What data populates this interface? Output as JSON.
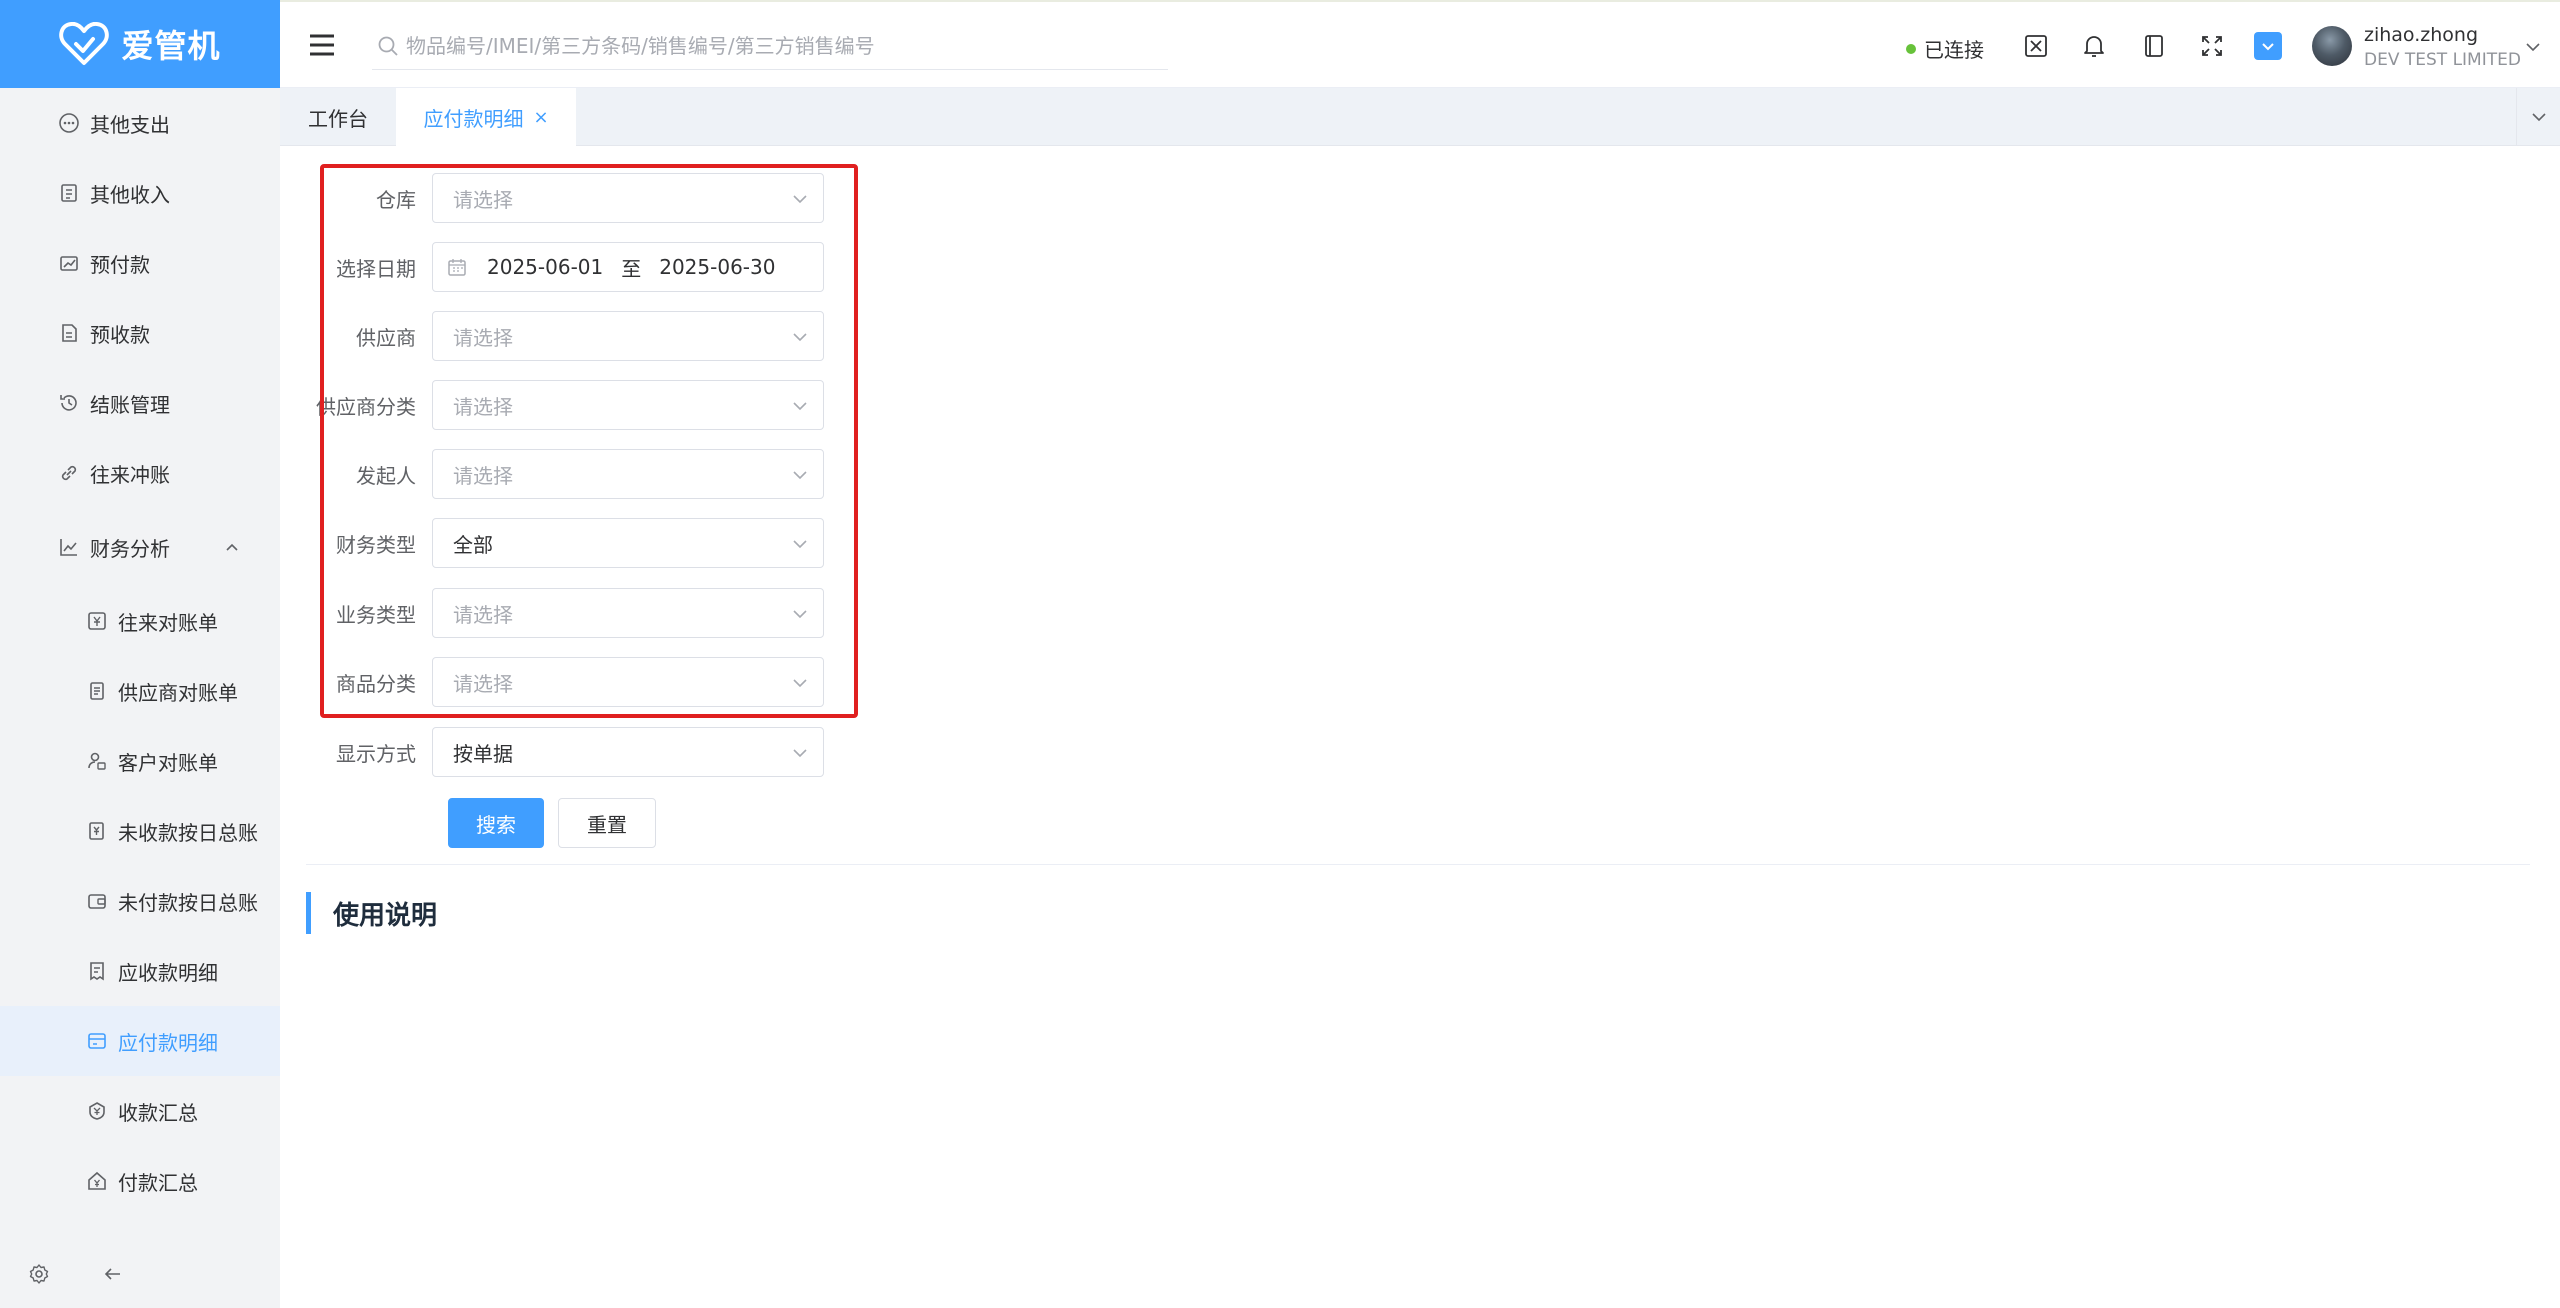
{
  "app": {
    "logo_text": "爱管机",
    "brand_color": "#409eff"
  },
  "sidebar": {
    "items": [
      {
        "label": "其他支出",
        "icon": "dots-circle-icon",
        "level": 1
      },
      {
        "label": "其他收入",
        "icon": "ledger-icon",
        "level": 1
      },
      {
        "label": "预付款",
        "icon": "chart-card-icon",
        "level": 1
      },
      {
        "label": "预收款",
        "icon": "document-icon",
        "level": 1
      },
      {
        "label": "结账管理",
        "icon": "history-icon",
        "level": 1
      },
      {
        "label": "往来冲账",
        "icon": "link-icon",
        "level": 1
      },
      {
        "label": "财务分析",
        "icon": "analysis-icon",
        "level": 1,
        "expanded": true
      },
      {
        "label": "往来对账单",
        "icon": "yen-card-icon",
        "level": 2
      },
      {
        "label": "供应商对账单",
        "icon": "doc-list-icon",
        "level": 2
      },
      {
        "label": "客户对账单",
        "icon": "user-lock-icon",
        "level": 2
      },
      {
        "label": "未收款按日总账",
        "icon": "yen-doc-icon",
        "level": 2
      },
      {
        "label": "未付款按日总账",
        "icon": "wallet-icon",
        "level": 2
      },
      {
        "label": "应收款明细",
        "icon": "receipt-icon",
        "level": 2
      },
      {
        "label": "应付款明细",
        "icon": "payable-icon",
        "level": 2,
        "active": true
      },
      {
        "label": "收款汇总",
        "icon": "coin-icon",
        "level": 2
      },
      {
        "label": "付款汇总",
        "icon": "home-money-icon",
        "level": 2
      }
    ]
  },
  "header": {
    "search_placeholder": "物品编号/IMEI/第三方条码/销售编号/第三方销售编号",
    "status": "已连接",
    "status_color": "#67c23a",
    "user": {
      "name": "zihao.zhong",
      "org": "DEV TEST LIMITED"
    }
  },
  "tabs": [
    {
      "label": "工作台",
      "active": false
    },
    {
      "label": "应付款明细",
      "active": true,
      "closable": true
    }
  ],
  "form": {
    "warehouse": {
      "label": "仓库",
      "placeholder": "请选择"
    },
    "date": {
      "label": "选择日期",
      "start": "2025-06-01",
      "separator": "至",
      "end": "2025-06-30"
    },
    "supplier": {
      "label": "供应商",
      "placeholder": "请选择"
    },
    "supplier_category": {
      "label": "供应商分类",
      "placeholder": "请选择"
    },
    "initiator": {
      "label": "发起人",
      "placeholder": "请选择"
    },
    "finance_type": {
      "label": "财务类型",
      "value": "全部"
    },
    "business_type": {
      "label": "业务类型",
      "placeholder": "请选择"
    },
    "product_category": {
      "label": "商品分类",
      "placeholder": "请选择"
    },
    "display_mode": {
      "label": "显示方式",
      "value": "按单据"
    },
    "search_button": "搜索",
    "reset_button": "重置"
  },
  "section": {
    "title": "使用说明"
  },
  "highlight_color": "#e02020"
}
